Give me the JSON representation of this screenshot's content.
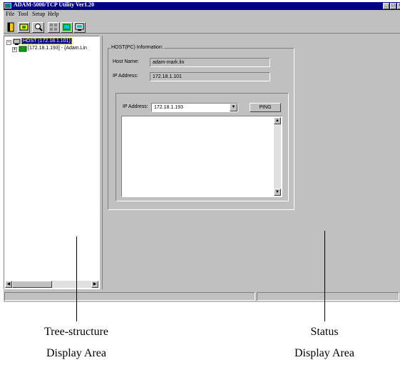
{
  "window": {
    "title": "ADAM-5000/TCP Utility Ver1.20",
    "caption_buttons": [
      "_",
      "□",
      "×"
    ]
  },
  "menu": [
    "File",
    "Tool",
    "Setup",
    "Help"
  ],
  "toolbar": {
    "buttons": [
      {
        "name": "exit-button",
        "icon": "door-icon"
      },
      {
        "name": "add-device-button",
        "icon": "device-icon"
      },
      {
        "name": "search-button",
        "icon": "magnifier-icon"
      },
      {
        "name": "grid-button",
        "icon": "grid-icon"
      },
      {
        "name": "network-button",
        "icon": "network-icon"
      },
      {
        "name": "monitor-button",
        "icon": "monitor-icon"
      }
    ]
  },
  "tree": {
    "host": "HOST (172.18.1.101)",
    "child": "[172.18.1.193] - {Adam.Lin"
  },
  "host_info": {
    "group_label": "HOST(PC)  Information:",
    "host_name_label": "Host Name:",
    "host_name_value": "adam-mark.lin",
    "ip_label": "IP Address:",
    "ip_value": "172.18.1.101"
  },
  "ping": {
    "ip_label": "IP Address:",
    "ip_value": "172.18.1.193",
    "button_label": "PING",
    "result_text": ""
  },
  "captions": {
    "tree_line1": "Tree-structure",
    "tree_line2": "Display Area",
    "status_line1": "Status",
    "status_line2": "Display Area"
  },
  "colors": {
    "title_bar": "#000080",
    "face": "#c0c0c0",
    "selection": "#000080"
  }
}
